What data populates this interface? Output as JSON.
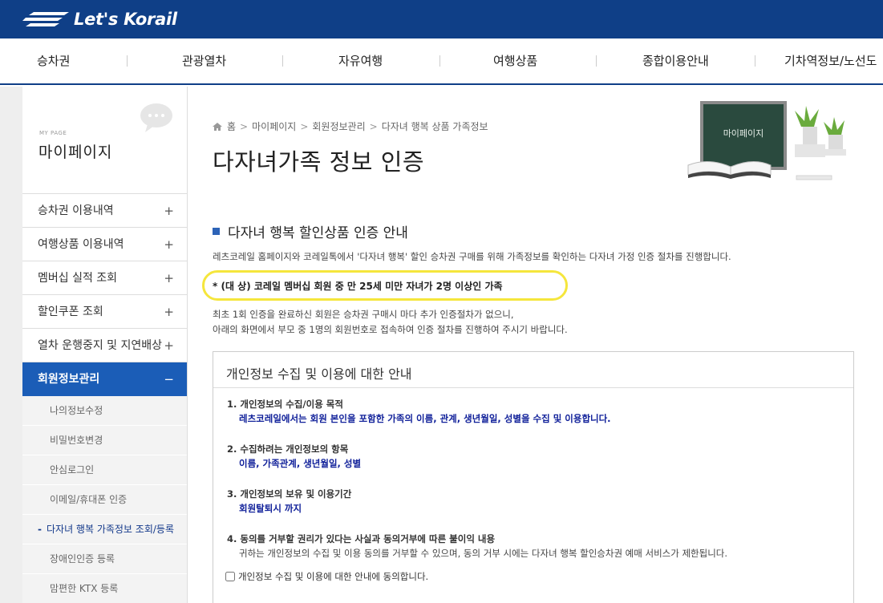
{
  "brand": {
    "name": "Let's Korail"
  },
  "nav": {
    "items": [
      {
        "label": "승차권"
      },
      {
        "label": "관광열차"
      },
      {
        "label": "자유여행"
      },
      {
        "label": "여행상품"
      },
      {
        "label": "종합이용안내"
      },
      {
        "label": "기차역정보/노선도"
      }
    ]
  },
  "sidebar": {
    "small_label": "MY PAGE",
    "title": "마이페이지",
    "menu": [
      {
        "label": "승차권 이용내역",
        "toggle": "+"
      },
      {
        "label": "여행상품 이용내역",
        "toggle": "+"
      },
      {
        "label": "멤버십 실적 조회",
        "toggle": "+"
      },
      {
        "label": "할인쿠폰 조회",
        "toggle": "+"
      },
      {
        "label": "열차 운행중지 및 지연배상",
        "toggle": "+"
      },
      {
        "label": "회원정보관리",
        "toggle": "−"
      }
    ],
    "submenu": [
      {
        "label": "나의정보수정"
      },
      {
        "label": "비밀번호변경"
      },
      {
        "label": "안심로그인"
      },
      {
        "label": "이메일/휴대폰 인증"
      },
      {
        "label": "다자녀 행복 가족정보 조회/등록",
        "marker": "-"
      },
      {
        "label": "장애인인증 등록"
      },
      {
        "label": "맘편한 KTX 등록"
      }
    ]
  },
  "breadcrumb": [
    "홈",
    "마이페이지",
    "회원정보관리",
    "다자녀 행복 상품 가족정보"
  ],
  "breadcrumb_sep": ">",
  "illustration": {
    "board_text": "마이페이지"
  },
  "page": {
    "title": "다자녀가족 정보 인증",
    "section_title": "다자녀 행복 할인상품 인증 안내",
    "intro": "레츠코레일 홈페이지와 코레일톡에서 '다자녀 행복' 할인 승차권 구매를 위해 가족정보를 확인하는 다자녀 가정 인증 절차를 진행합니다.",
    "target": "* (대 상) 코레일 멤버십 회원 중 만 25세 미만 자녀가 2명 이상인 가족",
    "note1": "최초 1회 인증을 완료하신 회원은 승차권 구매시 마다 추가 인증절차가 없으니,",
    "note2": "아래의 화면에서 부모 중 1명의 회원번호로 접속하여 인증 절차를 진행하여 주시기 바랍니다."
  },
  "privacy": {
    "title": "개인정보 수집 및 이용에 대한 안내",
    "items": [
      {
        "q": "1. 개인정보의 수집/이용 목적",
        "a": "레츠코레일에서는 회원 본인을 포함한 가족의 이름, 관계, 생년월일, 성별을 수집 및 이용합니다."
      },
      {
        "q": "2. 수집하려는 개인정보의 항목",
        "a": "이름, 가족관계, 생년월일, 성별"
      },
      {
        "q": "3. 개인정보의 보유 및 이용기간",
        "a": "회원탈퇴시 까지"
      },
      {
        "q": "4. 동의를 거부할 권리가 있다는 사실과 동의거부에 따른 불이익 내용",
        "a": "귀하는 개인정보의 수집 및 이용 동의를 거부할 수 있으며, 동의 거부 시에는 다자녀 행복 할인승차권 예매 서비스가 제한됩니다."
      }
    ],
    "agree_label": "개인정보 수집 및 이용에 대한 안내에 동의합니다."
  },
  "colors": {
    "topbar": "#0f3f87",
    "active_menu": "#1b5db7",
    "answer_text": "#11219a",
    "highlight": "#f5e63c"
  }
}
